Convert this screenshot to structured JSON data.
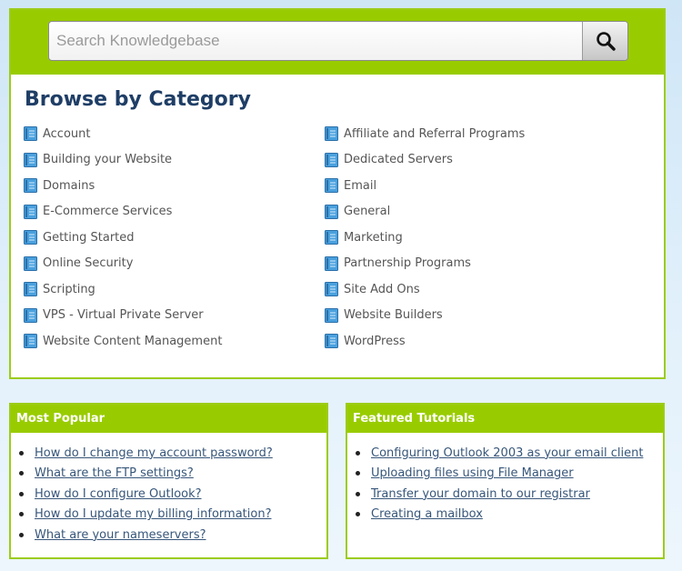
{
  "search": {
    "placeholder": "Search Knowledgebase"
  },
  "icons": {
    "search_button_icon": "magnifier-icon",
    "category_icon": "book-icon"
  },
  "browse": {
    "title": "Browse by Category",
    "left_column": [
      "Account",
      "Building your Website",
      "Domains",
      "E-Commerce Services",
      "Getting Started",
      "Online Security",
      "Scripting",
      "VPS - Virtual Private Server",
      "Website Content Management"
    ],
    "right_column": [
      "Affiliate and Referral Programs",
      "Dedicated Servers",
      "Email",
      "General",
      "Marketing",
      "Partnership Programs",
      "Site Add Ons",
      "Website Builders",
      "WordPress"
    ]
  },
  "most_popular": {
    "title": "Most Popular",
    "links": [
      "How do I change my account password?",
      "What are the FTP settings?",
      "How do I configure Outlook?",
      "How do I update my billing information?",
      "What are your nameservers?"
    ]
  },
  "featured_tutorials": {
    "title": "Featured Tutorials",
    "links": [
      "Configuring Outlook 2003 as your email client",
      "Uploading files using File Manager",
      "Transfer your domain to our registrar",
      "Creating a mailbox"
    ]
  },
  "colors": {
    "accent_green": "#99cc00",
    "title_blue": "#1f3e66",
    "link_blue": "#37567a",
    "category_text": "#555555"
  }
}
